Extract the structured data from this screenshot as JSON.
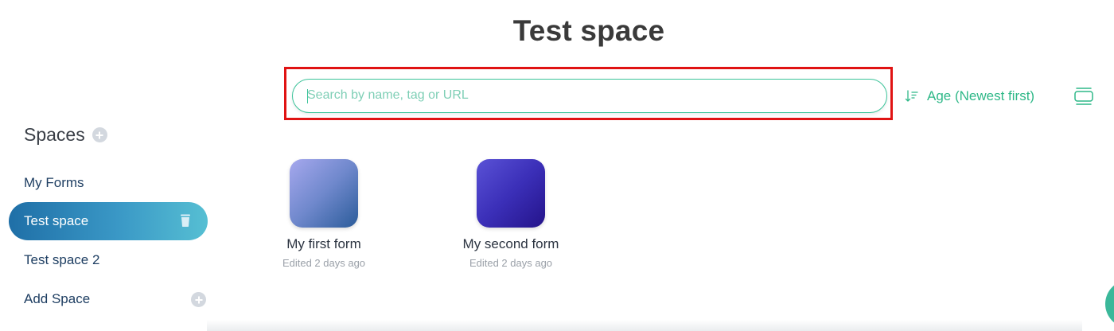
{
  "page": {
    "title": "Test space"
  },
  "search": {
    "placeholder": "Search by name, tag or URL",
    "value": ""
  },
  "sort": {
    "label": "Age (Newest first)",
    "icon": "sort-descending-icon"
  },
  "view_toggle": {
    "icon": "card-view-icon"
  },
  "sidebar": {
    "heading": "Spaces",
    "items": [
      {
        "label": "My Forms",
        "active": false
      },
      {
        "label": "Test space",
        "active": true
      },
      {
        "label": "Test space 2",
        "active": false
      },
      {
        "label": "Add Space",
        "active": false
      }
    ]
  },
  "forms": [
    {
      "name": "My first form",
      "edited": "Edited 2 days ago"
    },
    {
      "name": "My second form",
      "edited": "Edited 2 days ago"
    }
  ],
  "colors": {
    "accent": "#2fb888",
    "active_nav_start": "#1f6fa7",
    "active_nav_end": "#56bfd3",
    "highlight": "#e01313"
  }
}
